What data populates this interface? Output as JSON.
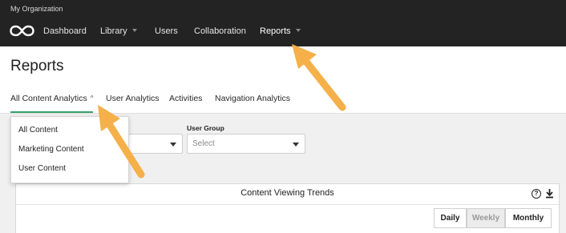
{
  "header": {
    "org_name": "My Organization",
    "nav": [
      {
        "label": "Dashboard",
        "has_caret": false
      },
      {
        "label": "Library",
        "has_caret": true
      },
      {
        "label": "Users",
        "has_caret": false
      },
      {
        "label": "Collaboration",
        "has_caret": false
      },
      {
        "label": "Reports",
        "has_caret": true,
        "active": true
      }
    ]
  },
  "page": {
    "title": "Reports"
  },
  "tabs": [
    {
      "label": "All Content Analytics",
      "active": true,
      "chevron": "^"
    },
    {
      "label": "User Analytics"
    },
    {
      "label": "Activities"
    },
    {
      "label": "Navigation Analytics"
    }
  ],
  "filters": {
    "user_group_label": "User Group",
    "user_group_value": "Select"
  },
  "dropdown": {
    "items": [
      "All Content",
      "Marketing Content",
      "User Content"
    ]
  },
  "panel": {
    "title": "Content Viewing Trends",
    "help_icon": "?",
    "periods": [
      {
        "label": "Daily"
      },
      {
        "label": "Weekly",
        "selected": true
      },
      {
        "label": "Monthly"
      }
    ]
  },
  "colors": {
    "topbar": "#232323",
    "active_tab_underline": "#39a06a",
    "annotation_arrow": "#f5b04a"
  }
}
